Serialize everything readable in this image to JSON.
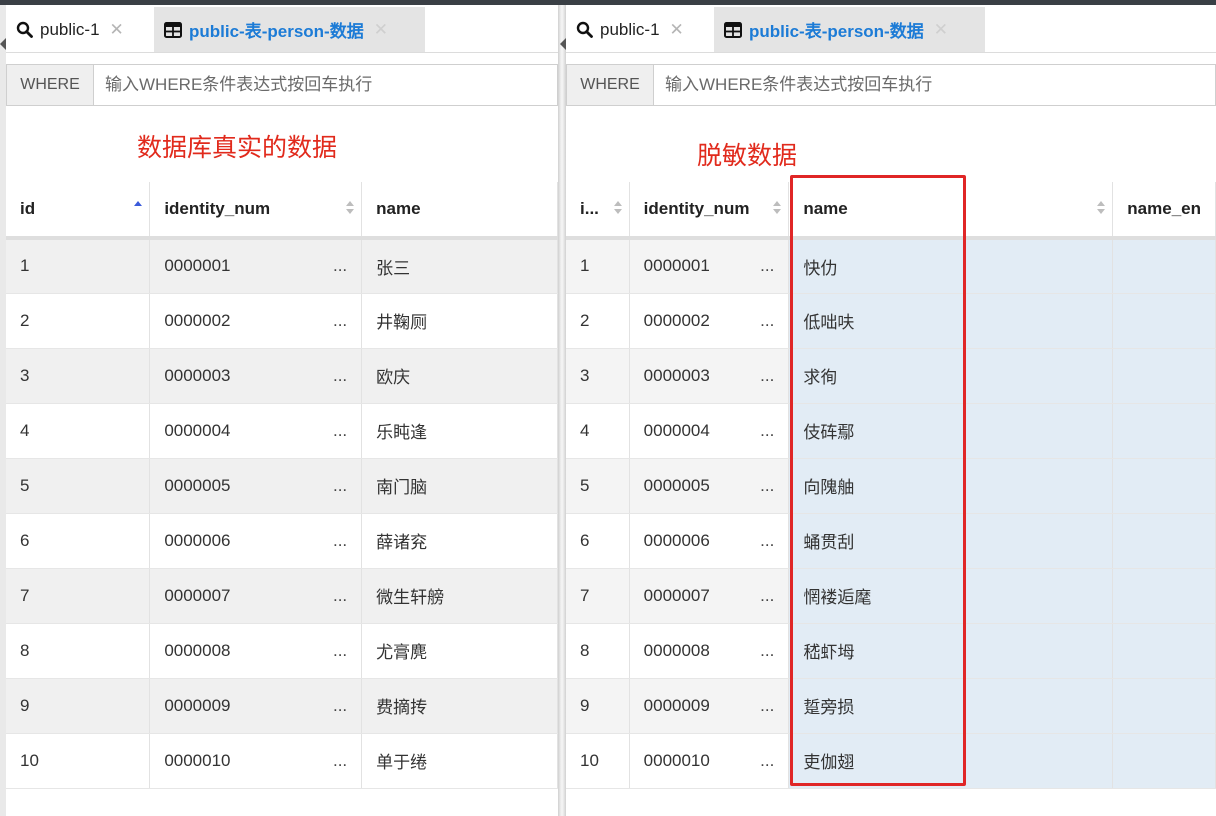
{
  "panels": [
    {
      "tabs": [
        {
          "label": "public-1",
          "icon": "search-icon",
          "active": true
        },
        {
          "label": "public-表-person-数据",
          "icon": "table-icon",
          "active": false
        }
      ],
      "where": {
        "label": "WHERE",
        "placeholder": "输入WHERE条件表达式按回车执行"
      },
      "annotation": "数据库真实的数据",
      "columns": [
        "id",
        "identity_num",
        "name"
      ],
      "rows": [
        {
          "id": "1",
          "identity_num": "0000001",
          "name": "张三"
        },
        {
          "id": "2",
          "identity_num": "0000002",
          "name": "井鞠厕"
        },
        {
          "id": "3",
          "identity_num": "0000003",
          "name": "欧庆"
        },
        {
          "id": "4",
          "identity_num": "0000004",
          "name": "乐盹逢"
        },
        {
          "id": "5",
          "identity_num": "0000005",
          "name": "南门脑"
        },
        {
          "id": "6",
          "identity_num": "0000006",
          "name": "薛诸兖"
        },
        {
          "id": "7",
          "identity_num": "0000007",
          "name": "微生轩艕"
        },
        {
          "id": "8",
          "identity_num": "0000008",
          "name": "尤膏麂"
        },
        {
          "id": "9",
          "identity_num": "0000009",
          "name": "费摘抟"
        },
        {
          "id": "10",
          "identity_num": "0000010",
          "name": "单于绻"
        }
      ]
    },
    {
      "tabs": [
        {
          "label": "public-1",
          "icon": "search-icon",
          "active": true
        },
        {
          "label": "public-表-person-数据",
          "icon": "table-icon",
          "active": false
        }
      ],
      "where": {
        "label": "WHERE",
        "placeholder": "输入WHERE条件表达式按回车执行"
      },
      "annotation": "脱敏数据",
      "columns": [
        "i...",
        "identity_num",
        "name",
        "name_en"
      ],
      "rows": [
        {
          "id": "1",
          "identity_num": "0000001",
          "name": "快仂"
        },
        {
          "id": "2",
          "identity_num": "0000002",
          "name": "低咄呋"
        },
        {
          "id": "3",
          "identity_num": "0000003",
          "name": "求徇"
        },
        {
          "id": "4",
          "identity_num": "0000004",
          "name": "伎砗鄢"
        },
        {
          "id": "5",
          "identity_num": "0000005",
          "name": "向隗舳"
        },
        {
          "id": "6",
          "identity_num": "0000006",
          "name": "蛹贯刮"
        },
        {
          "id": "7",
          "identity_num": "0000007",
          "name": "惘褛逅麾"
        },
        {
          "id": "8",
          "identity_num": "0000008",
          "name": "嵇虾坶"
        },
        {
          "id": "9",
          "identity_num": "0000009",
          "name": "踅旁损"
        },
        {
          "id": "10",
          "identity_num": "0000010",
          "name": "吏伽翅"
        }
      ]
    }
  ],
  "ellipsis": "...",
  "colors": {
    "accent": "#1c7bd6",
    "annotation": "#e12a1c",
    "highlight": "#e02626",
    "masked_bg": "#e2ecf5"
  }
}
